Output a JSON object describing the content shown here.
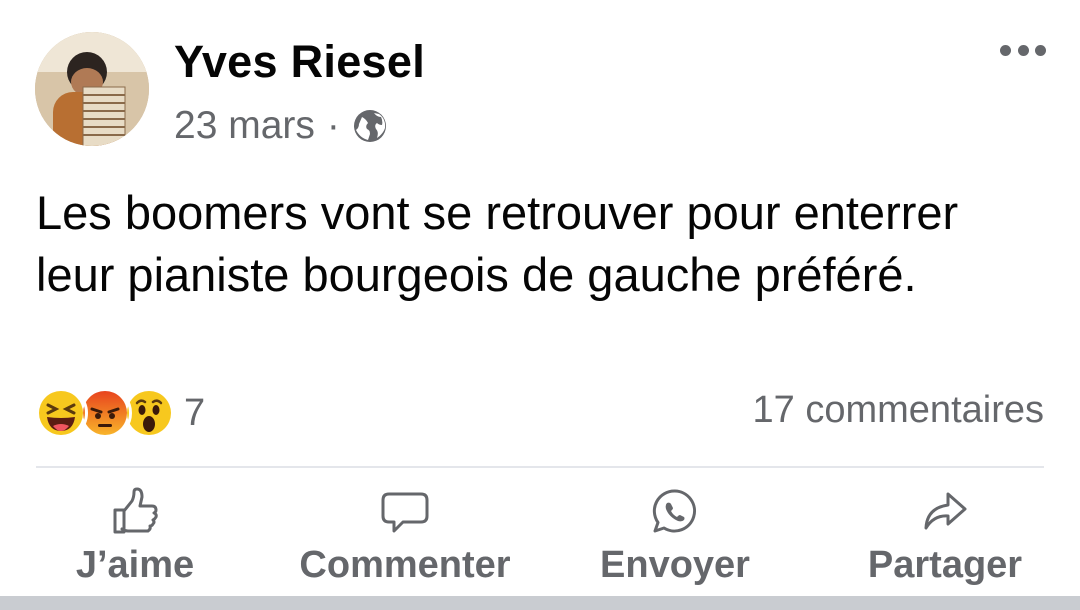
{
  "post": {
    "author": "Yves Riesel",
    "date": "23 mars",
    "separator": "·",
    "visibility_icon": "globe-icon",
    "text": "Les boomers vont se retrouver pour enterrer leur pianiste bourgeois de gauche préféré.",
    "reactions": {
      "types": [
        "laugh-emoji",
        "angry-emoji",
        "wow-emoji"
      ],
      "count": "7"
    },
    "comments_label": "17 commentaires"
  },
  "actions": [
    {
      "label": "J’aime",
      "icon": "like-icon"
    },
    {
      "label": "Commenter",
      "icon": "comment-icon"
    },
    {
      "label": "Envoyer",
      "icon": "whatsapp-icon"
    },
    {
      "label": "Partager",
      "icon": "share-icon"
    }
  ],
  "colors": {
    "text": "#050505",
    "secondary": "#65676b",
    "divider": "#e4e6eb"
  }
}
